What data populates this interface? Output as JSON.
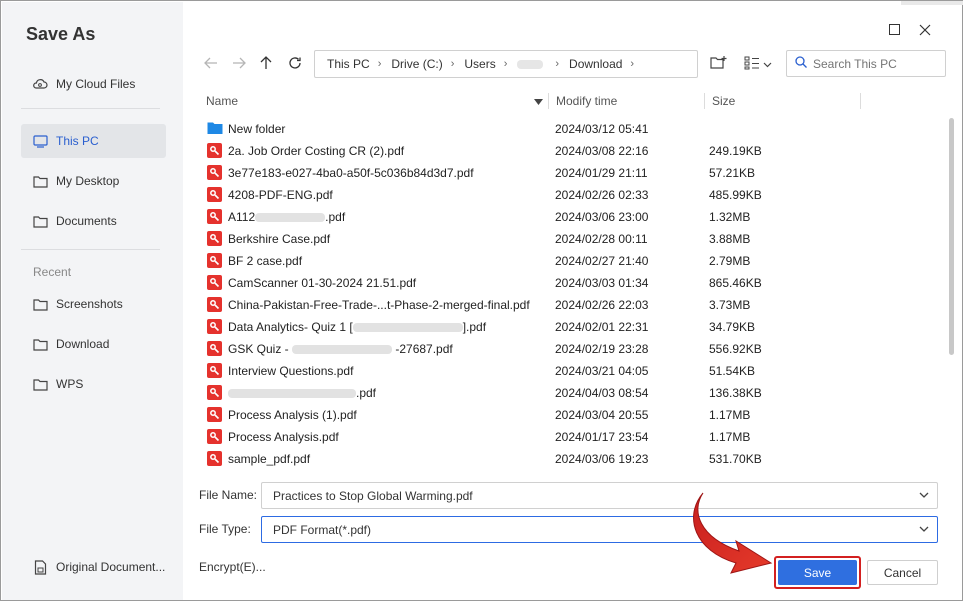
{
  "window": {
    "title": "Save As"
  },
  "sidebar": {
    "items": [
      {
        "label": "My Cloud Files",
        "icon": "cloud-icon"
      },
      {
        "label": "This PC",
        "icon": "monitor-icon",
        "active": true
      },
      {
        "label": "My Desktop",
        "icon": "folder-icon"
      },
      {
        "label": "Documents",
        "icon": "folder-icon"
      }
    ],
    "recent_label": "Recent",
    "recent_items": [
      {
        "label": "Screenshots",
        "icon": "folder-icon"
      },
      {
        "label": "Download",
        "icon": "folder-icon"
      },
      {
        "label": "WPS",
        "icon": "folder-icon"
      }
    ],
    "original_docs": "Original Document..."
  },
  "address": {
    "crumbs": [
      "This PC",
      "Drive (C:)",
      "Users",
      "Download"
    ]
  },
  "search": {
    "placeholder": "Search This PC"
  },
  "columns": {
    "name": "Name",
    "modify": "Modify time",
    "size": "Size"
  },
  "files": [
    {
      "name": "New folder",
      "type": "folder",
      "modified": "2024/03/12 05:41",
      "size": ""
    },
    {
      "name": "2a. Job Order Costing CR (2).pdf",
      "type": "pdf",
      "modified": "2024/03/08 22:16",
      "size": "249.19KB"
    },
    {
      "name": "3e77e183-e027-4ba0-a50f-5c036b84d3d7.pdf",
      "type": "pdf",
      "modified": "2024/01/29 21:11",
      "size": "57.21KB"
    },
    {
      "name": "4208-PDF-ENG.pdf",
      "type": "pdf",
      "modified": "2024/02/26 02:33",
      "size": "485.99KB"
    },
    {
      "name": "A112",
      "suffix": ".pdf",
      "redacted": 70,
      "type": "pdf",
      "modified": "2024/03/06 23:00",
      "size": "1.32MB"
    },
    {
      "name": "Berkshire Case.pdf",
      "type": "pdf",
      "modified": "2024/02/28 00:11",
      "size": "3.88MB"
    },
    {
      "name": "BF 2 case.pdf",
      "type": "pdf",
      "modified": "2024/02/27 21:40",
      "size": "2.79MB"
    },
    {
      "name": "CamScanner 01-30-2024 21.51.pdf",
      "type": "pdf",
      "modified": "2024/03/03 01:34",
      "size": "865.46KB"
    },
    {
      "name": "China-Pakistan-Free-Trade-...t-Phase-2-merged-final.pdf",
      "type": "pdf",
      "modified": "2024/02/26 22:03",
      "size": "3.73MB"
    },
    {
      "name": "Data Analytics- Quiz 1 [",
      "suffix": "].pdf",
      "redacted": 110,
      "type": "pdf",
      "modified": "2024/02/01 22:31",
      "size": "34.79KB"
    },
    {
      "name": "GSK Quiz - ",
      "suffix": " -27687.pdf",
      "redacted": 100,
      "type": "pdf",
      "modified": "2024/02/19 23:28",
      "size": "556.92KB"
    },
    {
      "name": "Interview Questions.pdf",
      "type": "pdf",
      "modified": "2024/03/21 04:05",
      "size": "51.54KB"
    },
    {
      "name": "",
      "suffix": ".pdf",
      "redacted": 128,
      "type": "pdf",
      "modified": "2024/04/03 08:54",
      "size": "136.38KB"
    },
    {
      "name": "Process Analysis (1).pdf",
      "type": "pdf",
      "modified": "2024/03/04 20:55",
      "size": "1.17MB"
    },
    {
      "name": "Process Analysis.pdf",
      "type": "pdf",
      "modified": "2024/01/17 23:54",
      "size": "1.17MB"
    },
    {
      "name": "sample_pdf.pdf",
      "type": "pdf",
      "modified": "2024/03/06 19:23",
      "size": "531.70KB"
    }
  ],
  "bottom": {
    "file_name_label": "File Name:",
    "file_name_value": "Practices to Stop Global Warming.pdf",
    "file_type_label": "File Type:",
    "file_type_value": "PDF Format(*.pdf)",
    "encrypt_label": "Encrypt(E)...",
    "save_label": "Save",
    "cancel_label": "Cancel"
  },
  "colors": {
    "accent": "#2f6fe0",
    "pdf_red": "#e5322d",
    "folder_blue": "#1e88e5",
    "highlight_red": "#d32020"
  }
}
